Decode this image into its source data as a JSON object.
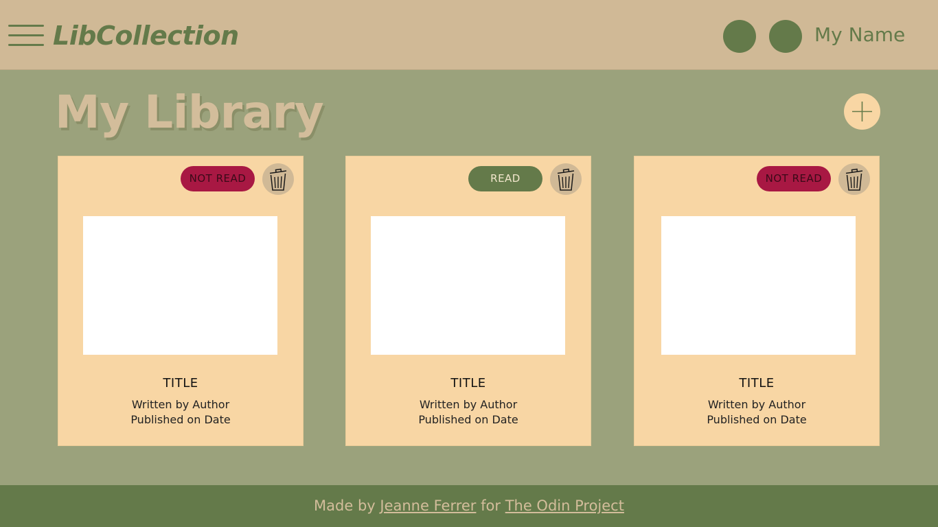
{
  "header": {
    "app_title": "LibCollection",
    "user_name": "My Name"
  },
  "main": {
    "page_title": "My Library",
    "add_icon": "plus-icon"
  },
  "books": [
    {
      "status": "NOT READ",
      "title": "TITLE",
      "author_line": "Written by Author",
      "date_line": "Published on Date"
    },
    {
      "status": "READ",
      "title": "TITLE",
      "author_line": "Written by Author",
      "date_line": "Published on Date"
    },
    {
      "status": "NOT READ",
      "title": "TITLE",
      "author_line": "Written by Author",
      "date_line": "Published on Date"
    }
  ],
  "footer": {
    "prefix": "Made by",
    "author_link": "Jeanne Ferrer",
    "middle": "for",
    "project_link": "The Odin Project"
  },
  "colors": {
    "header_bg": "#d0b996",
    "page_bg": "#9ba27c",
    "accent_green": "#647a4a",
    "card_bg": "#f8d6a4",
    "not_read_badge": "#a81843",
    "read_badge": "#647a4a"
  },
  "icons": {
    "menu": "hamburger-menu-icon",
    "trash": "trash-icon"
  }
}
